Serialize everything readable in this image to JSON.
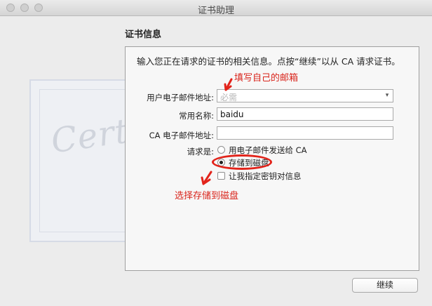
{
  "window": {
    "title": "证书助理"
  },
  "section": {
    "title": "证书信息"
  },
  "intro": "输入您正在请求的证书的相关信息。点按“继续”以从 CA 请求证书。",
  "form": {
    "email_label": "用户电子邮件地址:",
    "email_placeholder": "必需",
    "name_label": "常用名称:",
    "name_value": "baidu",
    "ca_email_label": "CA 电子邮件地址:",
    "ca_email_value": "",
    "request_label": "请求是:",
    "option_email": "用电子邮件发送给 CA",
    "option_disk": "存储到磁盘",
    "option_disk_selected": true,
    "option_keypair": "让我指定密钥对信息",
    "option_keypair_checked": false
  },
  "annotations": {
    "fill_email": "填写自己的邮箱",
    "choose_disk": "选择存储到磁盘",
    "color": "#d9241b"
  },
  "background": {
    "cert_script": "Certificate"
  },
  "buttons": {
    "continue": "继续"
  }
}
